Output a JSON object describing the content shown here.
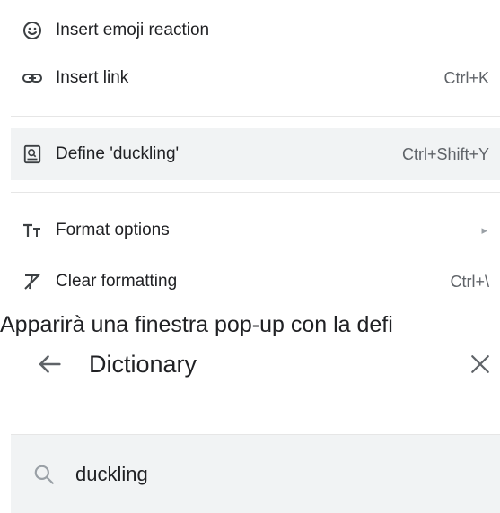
{
  "menu": {
    "items": [
      {
        "label": "Insert emoji reaction",
        "shortcut": "",
        "icon": "emoji-icon"
      },
      {
        "label": "Insert link",
        "shortcut": "Ctrl+K",
        "icon": "link-icon"
      },
      {
        "label": "Define 'duckling'",
        "shortcut": "Ctrl+Shift+Y",
        "icon": "define-icon",
        "highlighted": true
      },
      {
        "label": "Format options",
        "shortcut": "",
        "icon": "format-options-icon",
        "submenu_arrow": "▸"
      },
      {
        "label": "Clear formatting",
        "shortcut": "Ctrl+\\",
        "icon": "clear-formatting-icon"
      }
    ]
  },
  "caption": "Apparirà una finestra pop-up con la defi",
  "dictionary": {
    "title": "Dictionary",
    "search_value": "duckling"
  },
  "colors": {
    "highlight_bg": "#f1f3f4",
    "icon_gray": "#5f6368",
    "text": "#202124"
  }
}
